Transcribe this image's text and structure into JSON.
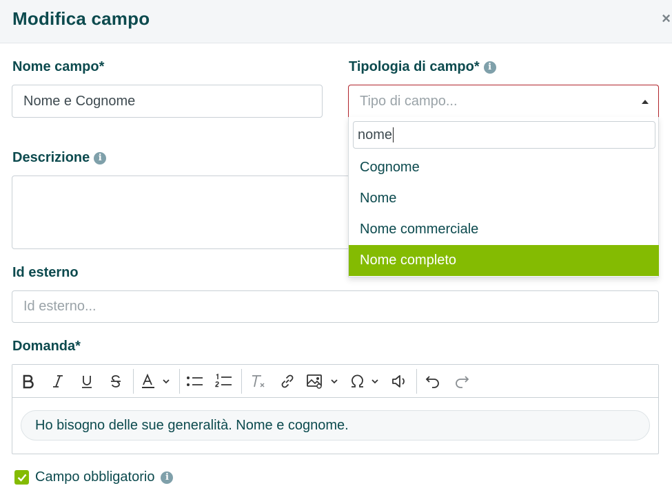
{
  "modal": {
    "title": "Modifica campo",
    "close_label": "×"
  },
  "fields": {
    "nome_campo": {
      "label": "Nome campo*",
      "value": "Nome e Cognome"
    },
    "tipologia": {
      "label": "Tipologia di campo*",
      "placeholder": "Tipo di campo..."
    },
    "descrizione": {
      "label": "Descrizione",
      "value": ""
    },
    "id_esterno": {
      "label": "Id esterno",
      "placeholder": "Id esterno..."
    },
    "domanda": {
      "label": "Domanda*",
      "content": "Ho bisogno delle sue generalità. Nome e cognome."
    }
  },
  "dropdown": {
    "search_value": "nome",
    "options": [
      "Cognome",
      "Nome",
      "Nome commerciale",
      "Nome completo"
    ],
    "highlighted": "Nome completo"
  },
  "toolbar_icons": [
    "bold-icon",
    "italic-icon",
    "underline-icon",
    "strikethrough-icon",
    "text-color-icon",
    "bulleted-list-icon",
    "numbered-list-icon",
    "remove-format-icon",
    "link-icon",
    "image-icon",
    "special-character-icon",
    "audio-icon",
    "undo-icon",
    "redo-icon"
  ],
  "checkbox": {
    "label": "Campo obbligatorio",
    "checked": true
  },
  "info_glyph": "i",
  "colors": {
    "primary_text": "#0c4a4e",
    "accent_green": "#84bb02",
    "error_border": "#b0232a",
    "header_bg": "#f4f6f8"
  }
}
